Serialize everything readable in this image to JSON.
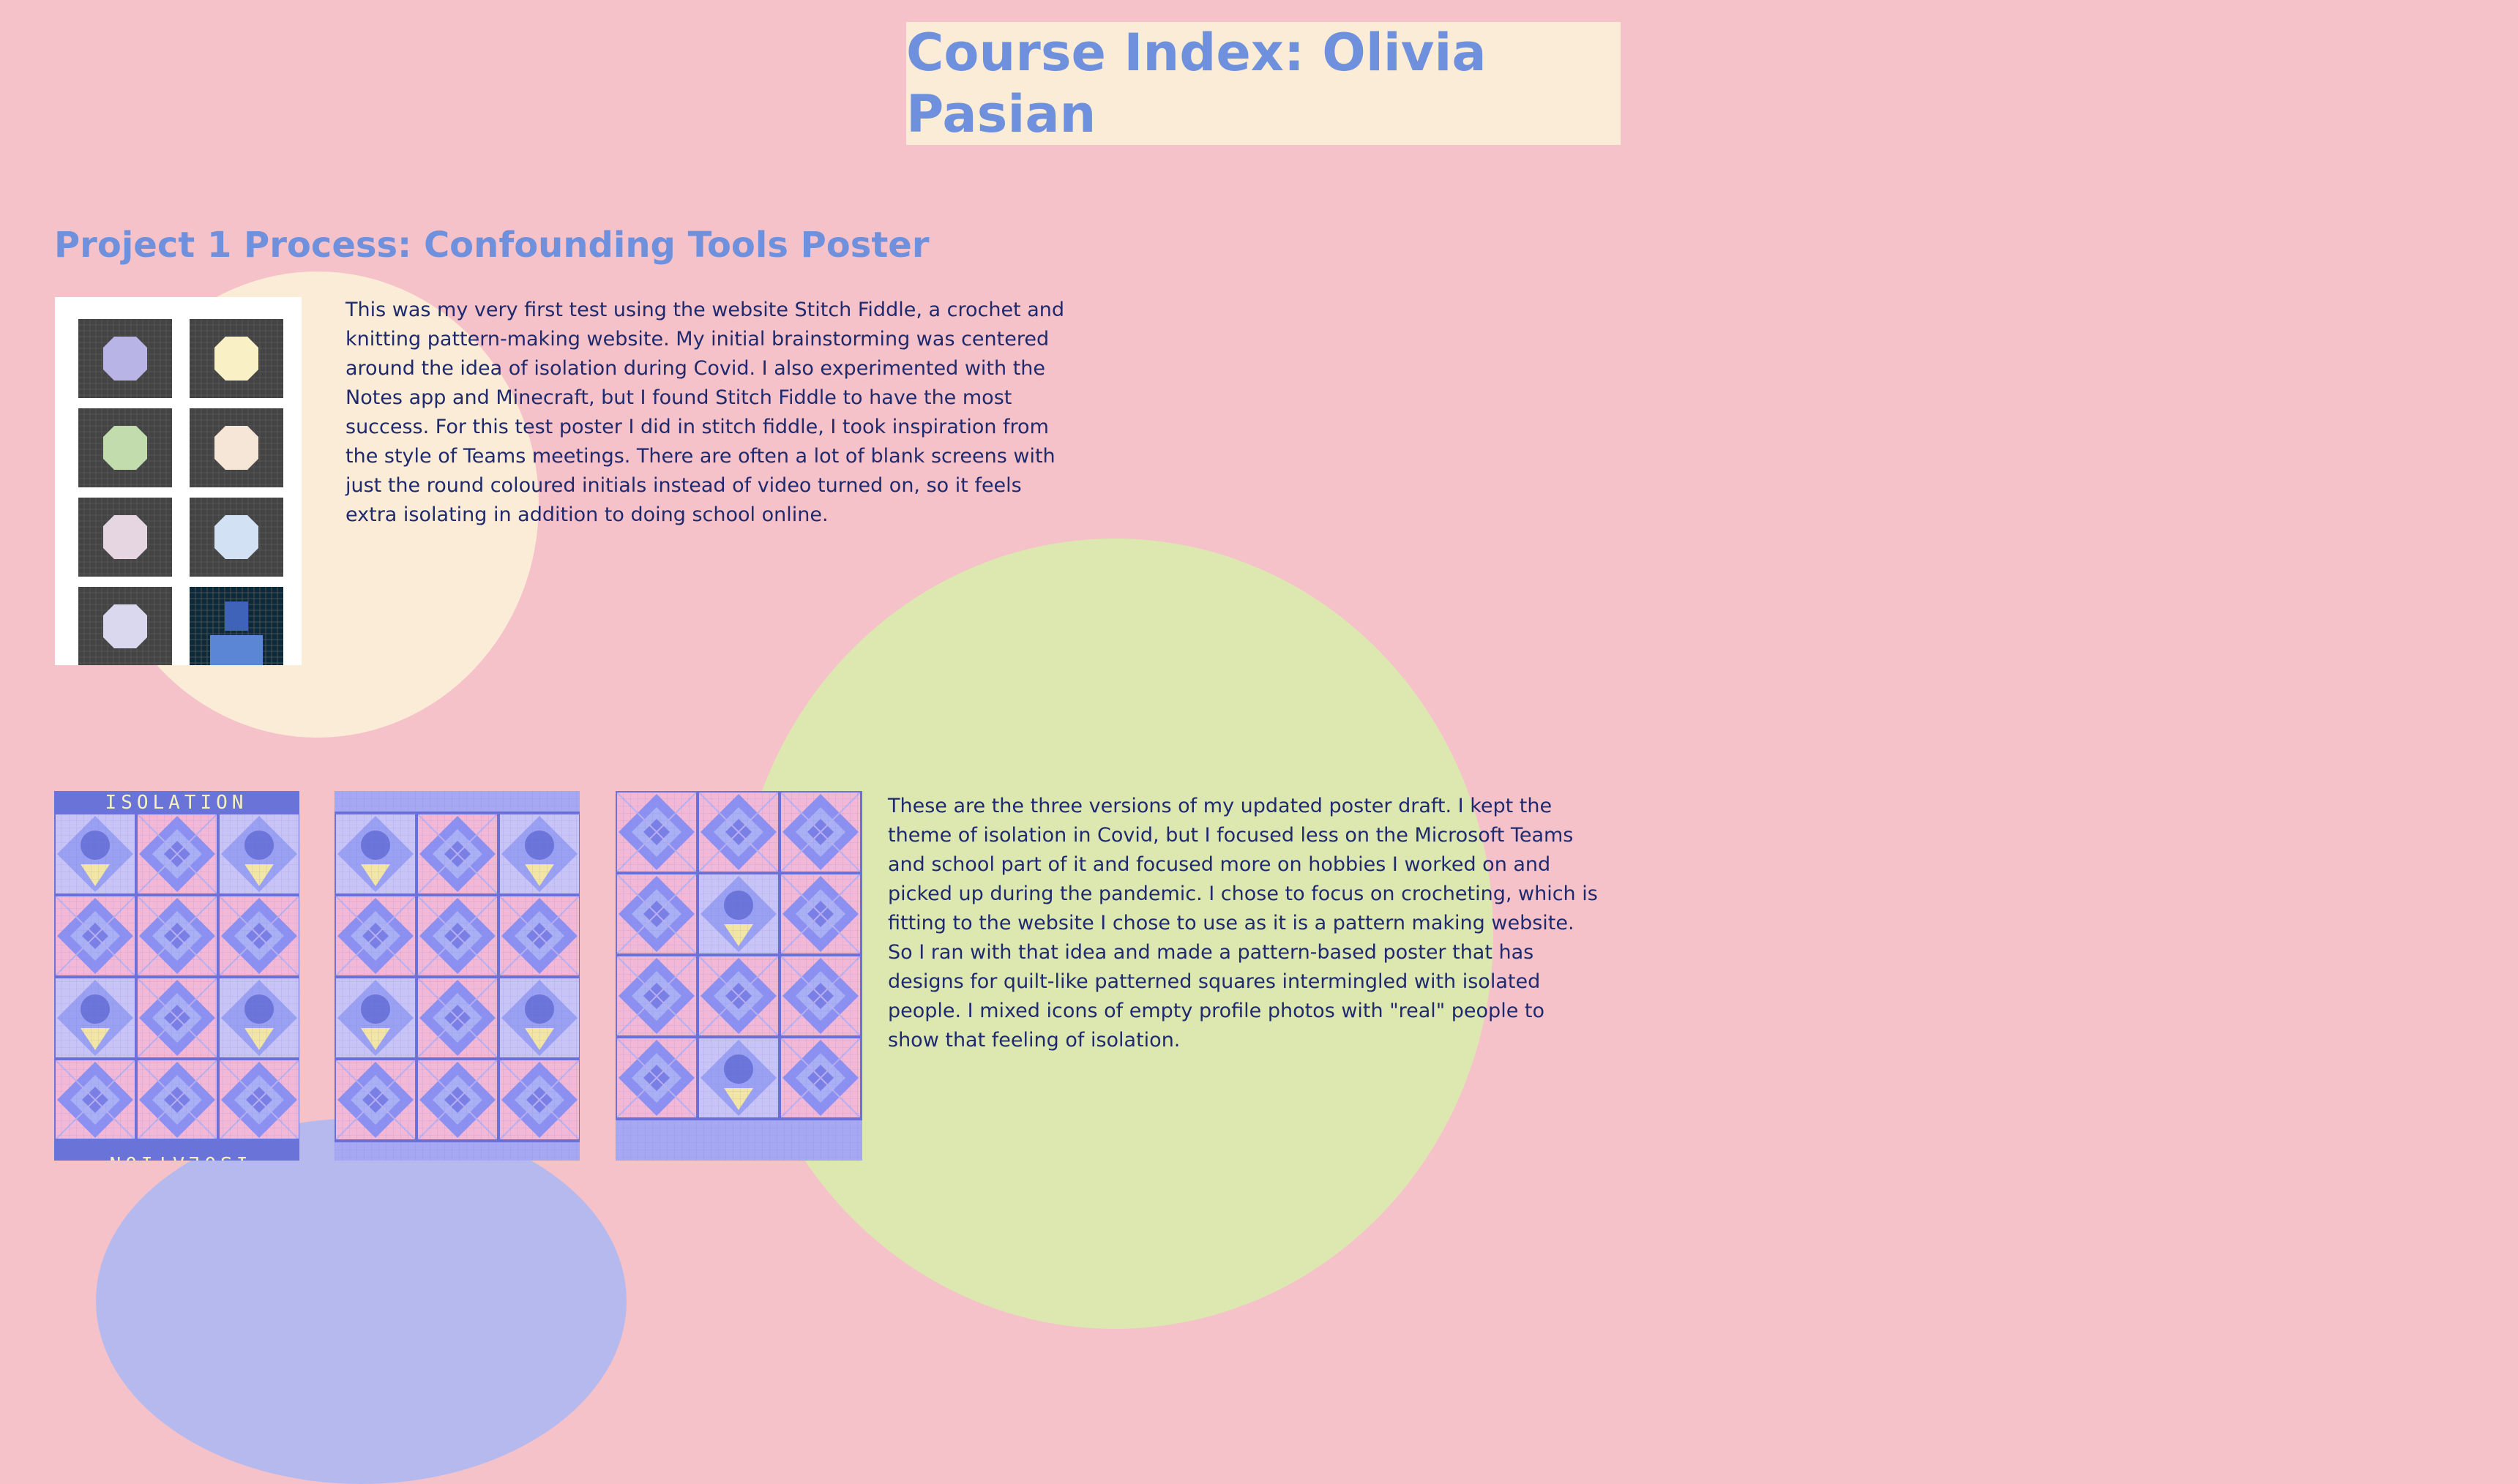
{
  "page": {
    "title": "Course Index: Olivia Pasian"
  },
  "project1": {
    "heading": "Project 1 Process: Confounding Tools Poster",
    "paragraph1": "This was my very first test using the website Stitch Fiddle, a crochet and knitting pattern-making website. My initial brainstorming was centered around the idea of isolation during Covid. I also experimented with the Notes app and Minecraft, but I found Stitch Fiddle to have the most success. For this test poster I did in stitch fiddle, I took inspiration from the style of Teams meetings. There are often a lot of blank screens with just the round coloured initials instead of video turned on, so it feels extra isolating in addition to doing school online.",
    "paragraph2": "These are the three versions of my updated poster draft. I kept the theme of isolation in Covid, but I focused less on the Microsoft Teams and school part of it and focused more on hobbies I worked on and picked up during the pandemic. I chose to focus on crocheting, which is fitting to the website I chose to use as it is a pattern making website. So I ran with that idea and made a pattern-based poster that has designs for quilt-like patterned squares intermingled with isolated people. I mixed icons of empty profile photos with \"real\" people to show that feeling of isolation.",
    "poster_top_text": "ISOLATION",
    "poster_bottom_text": "ISOLATION"
  },
  "colors": {
    "background": "#f5c2c9",
    "cream": "#faecd6",
    "green": "#dde8b0",
    "blue_circle": "#b6b9ee",
    "heading": "#6f90dc",
    "text": "#1f2a6e"
  },
  "test_poster_tile_colors": [
    "#b8b4e6",
    "#faf0c6",
    "#c2dcae",
    "#f6e6d8",
    "#e6d6e2",
    "#d2e2f4",
    "#dad8ee"
  ]
}
